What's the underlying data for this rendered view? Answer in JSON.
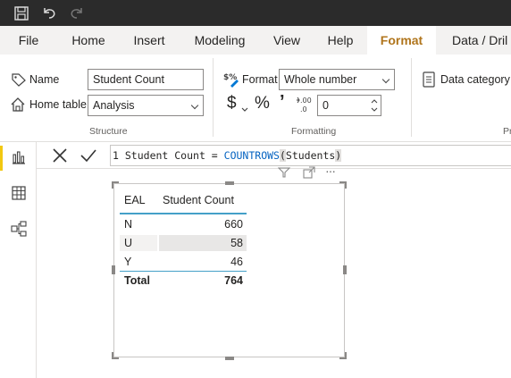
{
  "ribbon_tabs": [
    "File",
    "Home",
    "Insert",
    "Modeling",
    "View",
    "Help",
    "Format",
    "Data / Dril"
  ],
  "active_tab": "Format",
  "structure": {
    "name_label": "Name",
    "name_value": "Student Count",
    "home_table_label": "Home table",
    "home_table_value": "Analysis",
    "group_label": "Structure"
  },
  "formatting": {
    "format_label": "Format",
    "format_value": "Whole number",
    "currency_symbol": "$",
    "percent_symbol": "%",
    "comma_symbol": "’",
    "decimals_value": "0",
    "group_label": "Formatting"
  },
  "properties": {
    "data_category_label": "Data category",
    "group_label_partial": "Pr"
  },
  "formula": {
    "line_number": "1",
    "prefix": "Student Count = ",
    "function_name": "COUNTROWS",
    "open_paren": "(",
    "argument": "Students",
    "close_paren": ")"
  },
  "table_visual": {
    "columns": [
      "EAL",
      "Student Count"
    ],
    "rows": [
      {
        "label": "N",
        "value": "660"
      },
      {
        "label": "U",
        "value": "58"
      },
      {
        "label": "Y",
        "value": "46"
      }
    ],
    "total_label": "Total",
    "total_value": "764",
    "more_options": "···"
  },
  "colors": {
    "title_bar": "#2b2b2b",
    "active_tab": "#b0751c",
    "nav_active": "#f2c811",
    "header_rule": "#44a0c8",
    "function_blue": "#0563c1"
  },
  "icons": [
    "save-icon",
    "undo-icon",
    "redo-icon",
    "name-tag-icon",
    "home-table-icon",
    "format-icon",
    "currency-icon",
    "percent-icon",
    "comma-icon",
    "decimal-icon",
    "data-category-icon",
    "report-view-icon",
    "data-view-icon",
    "model-view-icon",
    "cancel-icon",
    "commit-icon",
    "filter-icon",
    "focus-mode-icon",
    "more-options-icon"
  ]
}
